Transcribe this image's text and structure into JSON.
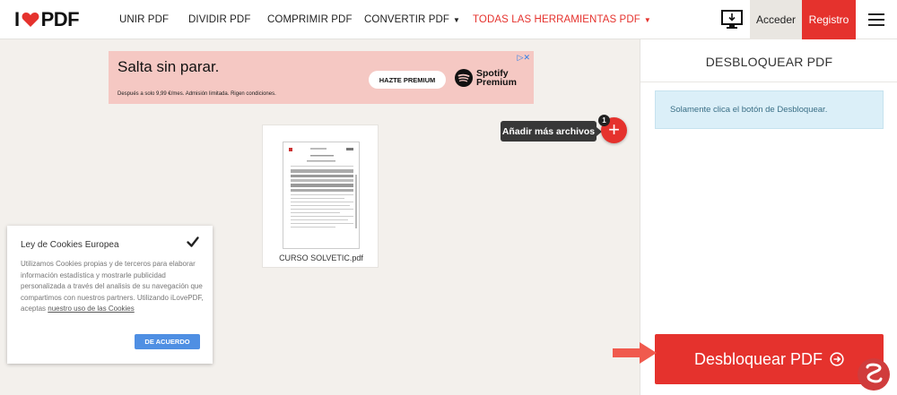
{
  "header": {
    "logo_left": "I",
    "logo_right": "PDF",
    "nav": [
      {
        "label": "UNIR PDF"
      },
      {
        "label": "DIVIDIR PDF"
      },
      {
        "label": "COMPRIMIR PDF"
      },
      {
        "label": "CONVERTIR PDF"
      },
      {
        "label": "TODAS LAS HERRAMIENTAS PDF"
      }
    ],
    "login": "Acceder",
    "register": "Registro"
  },
  "ad": {
    "title": "Salta sin parar.",
    "button": "HAZTE PREMIUM",
    "brand_line1": "Spotify",
    "brand_line2": "Premium",
    "fine_print": "Después a solo 9,99 €/mes. Admisión limitada. Rigen condiciones."
  },
  "workspace": {
    "add_more_label": "Añadir más archivos",
    "file_count": "1",
    "file_name": "CURSO SOLVETIC.pdf"
  },
  "cookie": {
    "title": "Ley de Cookies Europea",
    "text": "Utilizamos Cookies propias y de terceros para elaborar información estadística y mostrarle publicidad personalizada a través del analisis de su navegación que compartimos con nuestros partners. Utilizando iLovePDF, aceptas ",
    "link": "nuestro uso de las Cookies",
    "accept": "DE ACUERDO"
  },
  "panel": {
    "title": "DESBLOQUEAR PDF",
    "info": "Solamente clica el botón de Desbloquear.",
    "action": "Desbloquear PDF"
  },
  "colors": {
    "brand_red": "#e5322d",
    "background": "#f3f0ec",
    "info_bg": "#dbeff8",
    "accept_blue": "#4f8fe3"
  }
}
